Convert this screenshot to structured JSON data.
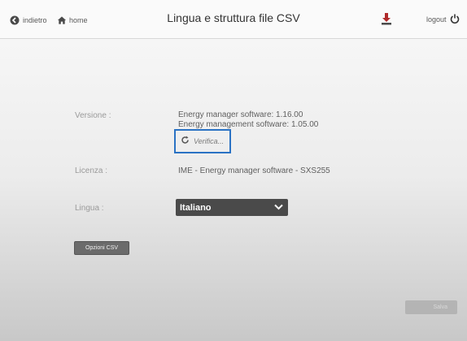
{
  "header": {
    "back_label": "indietro",
    "home_label": "home",
    "title": "Lingua e struttura file CSV",
    "logout_label": "logout"
  },
  "colors": {
    "accent_highlight": "#2a72c4",
    "download_icon": "#b02a2a",
    "dropdown_bg": "#4a4a4a"
  },
  "icons": {
    "back": "arrow-left-circle-icon",
    "home": "home-icon",
    "download": "download-icon",
    "logout": "power-icon",
    "verify": "refresh-icon",
    "dropdown": "chevron-down-icon"
  },
  "form": {
    "version_label": "Versione :",
    "version_line1": "Energy manager software: 1.16.00",
    "version_line2": "Energy management software: 1.05.00",
    "verify_label": "Verifica...",
    "license_label": "Licenza :",
    "license_value": "IME - Energy manager software - SXS255",
    "language_label": "Lingua :",
    "language_selected": "Italiano",
    "csv_options_label": "Opzioni CSV",
    "save_label": "Salva"
  }
}
